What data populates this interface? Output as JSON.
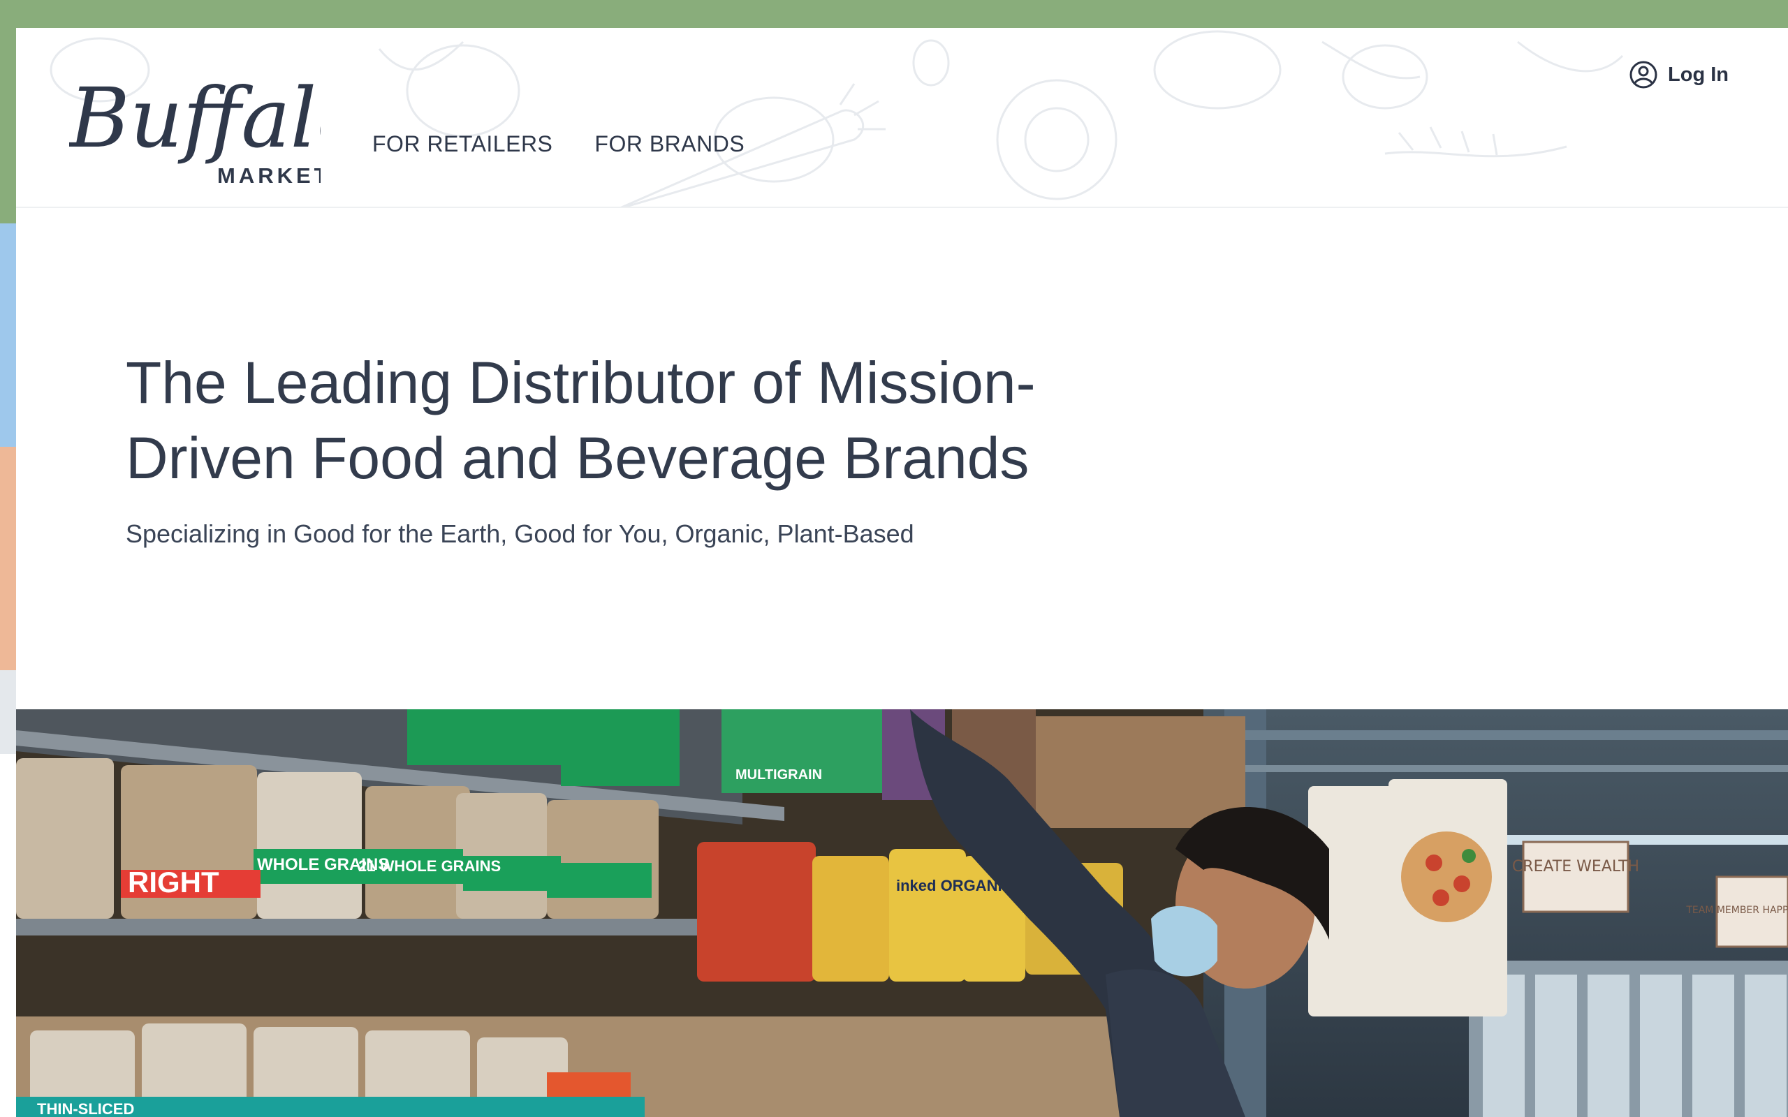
{
  "brand": {
    "logo_word": "Buffalo",
    "logo_subword": "MARKET"
  },
  "nav": {
    "items": [
      {
        "label": "FOR RETAILERS"
      },
      {
        "label": "FOR BRANDS"
      }
    ],
    "login_label": "Log In",
    "login_icon": "user-circle-icon"
  },
  "hero": {
    "title": "The Leading Distributor of Mission-Driven Food and Beverage Brands",
    "subtitle": "Specializing in Good for the Earth, Good for You, Organic, Plant-Based"
  },
  "photo": {
    "description_icon": "grocery-shelf-image",
    "signs": [
      "CREATE WEALTH",
      "TEAM MEMBER HAPPINESS"
    ],
    "packages": [
      "RIGHT",
      "WHOLE GRAINS",
      "21 WHOLE GRAINS",
      "THIN-SLICED",
      "inked ORGANICS",
      "MULTIGRAIN"
    ]
  },
  "colors": {
    "accent_green": "#89ad7b",
    "accent_blue": "#9ec8ec",
    "accent_peach": "#eeb897",
    "text_dark": "#323b4c"
  }
}
